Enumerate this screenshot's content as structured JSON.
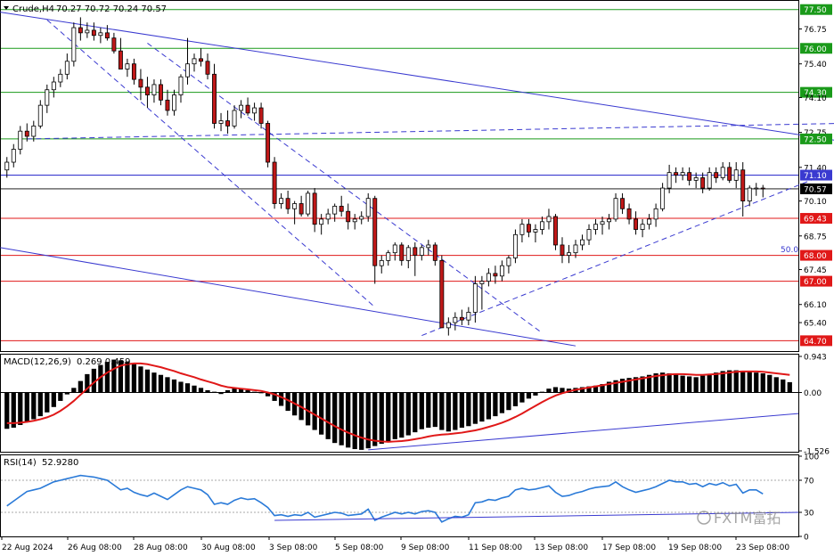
{
  "header": {
    "symbol": "Crude,H4",
    "ohlc": "70.27 70.72 70.24 70.57",
    "macd_label": "MACD(12,26,9)",
    "macd_values": "0.269 0.459",
    "rsi_label": "RSI(14)",
    "rsi_value": "52.9280",
    "fib_label": "50.0",
    "watermark": "FXTM富拓"
  },
  "colors": {
    "bull": "#2e8b2e",
    "bear": "#c01818",
    "horizontal_green": "#1a9a1a",
    "horizontal_red": "#e01818",
    "channel_blue": "#3a3ad0",
    "macd_signal": "#e01818",
    "rsi_line": "#2a7ad8"
  },
  "chart_data": [
    {
      "type": "candlestick",
      "pane": "price",
      "title": "Crude,H4",
      "y_ticks": [
        "77.50",
        "76.75",
        "76.00",
        "75.40",
        "74.30",
        "74.10",
        "72.75",
        "72.50",
        "71.40",
        "71.10",
        "70.57",
        "70.10",
        "69.43",
        "68.75",
        "68.00",
        "67.45",
        "67.00",
        "66.10",
        "65.40",
        "64.70"
      ],
      "ylim": [
        64.3,
        77.8
      ],
      "current_price": "70.57",
      "levels_green": [
        77.5,
        76.0,
        74.3,
        72.5
      ],
      "levels_red": [
        69.43,
        68.0,
        67.0,
        64.7
      ],
      "level_blue": 71.1,
      "level_black": 70.57,
      "x_ticks": [
        "22 Aug 2024",
        "26 Aug 08:00",
        "28 Aug 08:00",
        "30 Aug 08:00",
        "3 Sep 08:00",
        "5 Sep 08:00",
        "9 Sep 08:00",
        "11 Sep 08:00",
        "13 Sep 08:00",
        "17 Sep 08:00",
        "19 Sep 08:00",
        "23 Sep 08:00"
      ],
      "candles": [
        [
          71.3,
          71.8,
          71.0,
          71.6
        ],
        [
          71.6,
          72.3,
          71.4,
          72.1
        ],
        [
          72.1,
          73.0,
          71.9,
          72.8
        ],
        [
          72.8,
          73.1,
          72.4,
          72.6
        ],
        [
          72.6,
          73.2,
          72.4,
          73.0
        ],
        [
          73.0,
          74.0,
          72.9,
          73.8
        ],
        [
          73.8,
          74.6,
          73.5,
          74.4
        ],
        [
          74.4,
          74.9,
          74.1,
          74.7
        ],
        [
          74.7,
          75.2,
          74.5,
          75.0
        ],
        [
          75.0,
          75.8,
          74.8,
          75.5
        ],
        [
          75.5,
          77.0,
          75.3,
          76.8
        ],
        [
          76.8,
          77.2,
          76.3,
          76.6
        ],
        [
          76.6,
          77.0,
          76.4,
          76.7
        ],
        [
          76.7,
          77.0,
          76.3,
          76.5
        ],
        [
          76.5,
          76.8,
          76.2,
          76.6
        ],
        [
          76.6,
          76.9,
          76.3,
          76.4
        ],
        [
          76.4,
          76.6,
          75.8,
          75.9
        ],
        [
          75.9,
          76.4,
          75.4,
          75.2
        ],
        [
          75.2,
          75.6,
          74.9,
          75.4
        ],
        [
          75.4,
          75.6,
          74.6,
          74.8
        ],
        [
          74.8,
          75.2,
          74.0,
          74.5
        ],
        [
          74.5,
          74.9,
          73.7,
          74.2
        ],
        [
          74.2,
          74.8,
          73.9,
          74.6
        ],
        [
          74.6,
          74.8,
          73.8,
          74.0
        ],
        [
          74.0,
          74.4,
          73.4,
          73.6
        ],
        [
          73.6,
          74.4,
          73.4,
          74.2
        ],
        [
          74.2,
          75.0,
          73.9,
          74.9
        ],
        [
          74.9,
          76.4,
          74.6,
          75.4
        ],
        [
          75.4,
          75.8,
          75.1,
          75.6
        ],
        [
          75.6,
          76.0,
          75.3,
          75.5
        ],
        [
          75.5,
          75.8,
          74.8,
          75.0
        ],
        [
          75.0,
          75.4,
          72.9,
          73.1
        ],
        [
          73.1,
          73.5,
          72.8,
          73.2
        ],
        [
          73.2,
          73.6,
          72.7,
          73.0
        ],
        [
          73.0,
          73.8,
          72.9,
          73.6
        ],
        [
          73.6,
          74.0,
          73.3,
          73.8
        ],
        [
          73.8,
          74.1,
          73.4,
          73.5
        ],
        [
          73.5,
          73.9,
          73.2,
          73.7
        ],
        [
          73.7,
          73.9,
          72.9,
          73.1
        ],
        [
          73.1,
          73.2,
          71.4,
          71.6
        ],
        [
          71.6,
          71.8,
          69.8,
          70.0
        ],
        [
          70.0,
          70.4,
          69.8,
          70.2
        ],
        [
          70.2,
          70.5,
          69.6,
          69.8
        ],
        [
          69.8,
          70.1,
          69.2,
          70.0
        ],
        [
          70.0,
          70.3,
          69.5,
          69.6
        ],
        [
          69.6,
          70.5,
          69.5,
          70.4
        ],
        [
          70.4,
          70.6,
          68.9,
          69.2
        ],
        [
          69.2,
          69.6,
          68.8,
          69.4
        ],
        [
          69.4,
          69.8,
          69.2,
          69.6
        ],
        [
          69.6,
          70.0,
          69.3,
          69.9
        ],
        [
          69.9,
          70.3,
          69.5,
          69.7
        ],
        [
          69.7,
          70.0,
          69.0,
          69.3
        ],
        [
          69.3,
          69.6,
          69.0,
          69.4
        ],
        [
          69.4,
          69.7,
          69.2,
          69.5
        ],
        [
          69.5,
          70.4,
          69.3,
          70.2
        ],
        [
          70.2,
          70.3,
          66.9,
          67.6
        ],
        [
          67.6,
          68.0,
          67.3,
          67.8
        ],
        [
          67.8,
          68.2,
          67.6,
          68.1
        ],
        [
          68.1,
          68.5,
          67.8,
          68.4
        ],
        [
          68.4,
          68.5,
          67.6,
          67.8
        ],
        [
          67.8,
          68.4,
          67.5,
          68.3
        ],
        [
          68.3,
          68.5,
          67.2,
          68.0
        ],
        [
          68.0,
          68.4,
          67.8,
          68.3
        ],
        [
          68.3,
          68.6,
          68.0,
          68.4
        ],
        [
          68.4,
          68.5,
          67.6,
          67.8
        ],
        [
          67.8,
          68.0,
          66.1,
          65.2
        ],
        [
          65.2,
          65.6,
          64.9,
          65.4
        ],
        [
          65.4,
          65.8,
          65.1,
          65.6
        ],
        [
          65.6,
          65.9,
          65.3,
          65.5
        ],
        [
          65.5,
          66.0,
          65.3,
          65.8
        ],
        [
          65.8,
          67.2,
          65.4,
          66.9
        ],
        [
          66.9,
          67.2,
          65.9,
          67.0
        ],
        [
          67.0,
          67.5,
          66.8,
          67.3
        ],
        [
          67.3,
          67.6,
          66.9,
          67.2
        ],
        [
          67.2,
          67.8,
          67.0,
          67.6
        ],
        [
          67.6,
          68.0,
          67.3,
          67.9
        ],
        [
          67.9,
          69.0,
          67.7,
          68.8
        ],
        [
          68.8,
          69.4,
          68.5,
          69.2
        ],
        [
          69.2,
          69.4,
          68.7,
          68.9
        ],
        [
          68.9,
          69.2,
          68.5,
          69.0
        ],
        [
          69.0,
          69.5,
          68.8,
          69.3
        ],
        [
          69.3,
          69.8,
          69.0,
          69.5
        ],
        [
          69.5,
          69.6,
          68.2,
          68.4
        ],
        [
          68.4,
          68.7,
          67.7,
          68.0
        ],
        [
          68.0,
          68.4,
          67.7,
          68.1
        ],
        [
          68.1,
          68.6,
          67.9,
          68.4
        ],
        [
          68.4,
          68.8,
          68.2,
          68.6
        ],
        [
          68.6,
          69.2,
          68.4,
          69.0
        ],
        [
          69.0,
          69.4,
          68.8,
          69.2
        ],
        [
          69.2,
          69.5,
          68.8,
          69.3
        ],
        [
          69.3,
          69.6,
          69.0,
          69.4
        ],
        [
          69.4,
          70.4,
          69.3,
          70.2
        ],
        [
          70.2,
          70.4,
          69.6,
          69.8
        ],
        [
          69.8,
          70.0,
          69.2,
          69.4
        ],
        [
          69.4,
          69.7,
          68.8,
          69.0
        ],
        [
          69.0,
          69.4,
          68.7,
          69.2
        ],
        [
          69.2,
          69.6,
          69.0,
          69.4
        ],
        [
          69.4,
          70.0,
          69.1,
          69.8
        ],
        [
          69.8,
          70.8,
          69.7,
          70.6
        ],
        [
          70.6,
          71.5,
          70.4,
          71.2
        ],
        [
          71.2,
          71.4,
          70.8,
          71.1
        ],
        [
          71.1,
          71.4,
          70.9,
          71.2
        ],
        [
          71.2,
          71.4,
          70.7,
          70.9
        ],
        [
          70.9,
          71.2,
          70.6,
          71.0
        ],
        [
          71.0,
          71.2,
          70.4,
          70.6
        ],
        [
          70.6,
          71.4,
          70.5,
          71.2
        ],
        [
          71.2,
          71.4,
          70.8,
          71.0
        ],
        [
          71.0,
          71.6,
          70.9,
          71.4
        ],
        [
          71.4,
          71.6,
          70.8,
          70.9
        ],
        [
          70.9,
          71.6,
          70.6,
          71.3
        ],
        [
          71.3,
          71.6,
          69.5,
          70.1
        ],
        [
          70.1,
          70.7,
          69.9,
          70.6
        ],
        [
          70.6,
          70.8,
          70.3,
          70.6
        ],
        [
          70.6,
          70.72,
          70.24,
          70.57
        ]
      ]
    },
    {
      "type": "bar",
      "pane": "macd",
      "title": "MACD(12,26,9)",
      "y_ticks": [
        "0.943",
        "0.00",
        "-1.526"
      ],
      "ylim": [
        -1.526,
        0.943
      ],
      "histogram": [
        -0.95,
        -0.92,
        -0.85,
        -0.78,
        -0.7,
        -0.62,
        -0.52,
        -0.38,
        -0.22,
        -0.05,
        0.12,
        0.3,
        0.48,
        0.62,
        0.72,
        0.8,
        0.86,
        0.84,
        0.8,
        0.74,
        0.68,
        0.6,
        0.52,
        0.46,
        0.4,
        0.34,
        0.28,
        0.24,
        0.18,
        0.12,
        0.06,
        0.02,
        -0.04,
        0.06,
        0.12,
        0.1,
        0.06,
        0.02,
        -0.02,
        -0.1,
        -0.22,
        -0.35,
        -0.48,
        -0.6,
        -0.72,
        -0.86,
        -0.98,
        -1.1,
        -1.22,
        -1.32,
        -1.38,
        -1.44,
        -1.48,
        -1.5,
        -1.46,
        -1.4,
        -1.34,
        -1.3,
        -1.22,
        -1.18,
        -1.12,
        -1.04,
        -0.96,
        -0.92,
        -0.9,
        -0.98,
        -1.02,
        -0.98,
        -0.92,
        -0.88,
        -0.82,
        -0.76,
        -0.7,
        -0.62,
        -0.54,
        -0.46,
        -0.36,
        -0.26,
        -0.16,
        -0.08,
        0.02,
        0.1,
        0.14,
        0.12,
        0.1,
        0.12,
        0.14,
        0.16,
        0.18,
        0.22,
        0.28,
        0.32,
        0.36,
        0.38,
        0.4,
        0.42,
        0.46,
        0.5,
        0.52,
        0.5,
        0.48,
        0.44,
        0.42,
        0.4,
        0.44,
        0.48,
        0.52,
        0.56,
        0.58,
        0.58,
        0.56,
        0.54,
        0.52,
        0.5,
        0.46,
        0.4,
        0.34,
        0.27
      ],
      "signal": [
        -0.8,
        -0.8,
        -0.79,
        -0.77,
        -0.74,
        -0.7,
        -0.65,
        -0.58,
        -0.48,
        -0.36,
        -0.22,
        -0.06,
        0.1,
        0.26,
        0.4,
        0.52,
        0.62,
        0.7,
        0.74,
        0.76,
        0.76,
        0.74,
        0.7,
        0.66,
        0.61,
        0.56,
        0.5,
        0.45,
        0.4,
        0.34,
        0.29,
        0.24,
        0.18,
        0.14,
        0.12,
        0.1,
        0.08,
        0.06,
        0.04,
        0.0,
        -0.05,
        -0.12,
        -0.2,
        -0.29,
        -0.38,
        -0.48,
        -0.58,
        -0.68,
        -0.78,
        -0.88,
        -0.97,
        -1.05,
        -1.12,
        -1.18,
        -1.23,
        -1.26,
        -1.28,
        -1.29,
        -1.28,
        -1.27,
        -1.25,
        -1.22,
        -1.19,
        -1.15,
        -1.12,
        -1.1,
        -1.09,
        -1.07,
        -1.05,
        -1.02,
        -0.99,
        -0.95,
        -0.9,
        -0.85,
        -0.79,
        -0.72,
        -0.64,
        -0.55,
        -0.45,
        -0.35,
        -0.25,
        -0.16,
        -0.08,
        -0.02,
        0.03,
        0.07,
        0.1,
        0.13,
        0.16,
        0.19,
        0.22,
        0.25,
        0.28,
        0.31,
        0.34,
        0.37,
        0.4,
        0.43,
        0.45,
        0.47,
        0.48,
        0.48,
        0.47,
        0.46,
        0.46,
        0.47,
        0.48,
        0.5,
        0.52,
        0.54,
        0.55,
        0.55,
        0.55,
        0.54,
        0.52,
        0.5,
        0.48,
        0.459
      ]
    },
    {
      "type": "line",
      "pane": "rsi",
      "title": "RSI(14)",
      "y_ticks": [
        "100",
        "70",
        "30",
        "0"
      ],
      "ylim": [
        0,
        100
      ],
      "values": [
        38,
        44,
        50,
        56,
        58,
        60,
        64,
        68,
        70,
        72,
        74,
        76,
        75,
        74,
        72,
        70,
        64,
        58,
        60,
        55,
        52,
        50,
        54,
        50,
        46,
        52,
        58,
        62,
        60,
        58,
        52,
        40,
        42,
        40,
        45,
        48,
        46,
        47,
        42,
        36,
        26,
        27,
        25,
        27,
        26,
        30,
        24,
        26,
        28,
        30,
        29,
        26,
        27,
        28,
        34,
        20,
        24,
        27,
        30,
        28,
        30,
        28,
        31,
        32,
        30,
        18,
        22,
        25,
        24,
        27,
        42,
        43,
        46,
        45,
        48,
        50,
        58,
        60,
        58,
        59,
        61,
        63,
        55,
        50,
        51,
        54,
        56,
        59,
        61,
        62,
        63,
        68,
        62,
        58,
        55,
        57,
        59,
        62,
        66,
        70,
        68,
        68,
        65,
        66,
        62,
        66,
        64,
        67,
        63,
        65,
        54,
        58,
        58,
        52.928
      ],
      "trendline_label": ""
    }
  ]
}
